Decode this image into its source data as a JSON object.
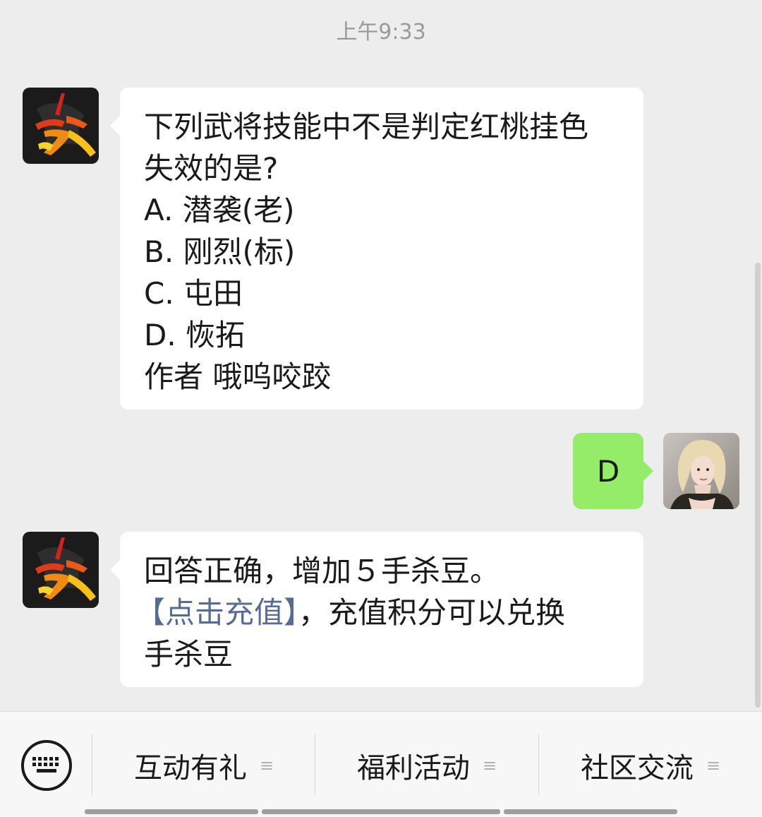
{
  "status": {
    "time": "上午9:33"
  },
  "messages": [
    {
      "sender": "bot",
      "lines": [
        "下列武将技能中不是判定红桃挂色",
        "失效的是?",
        "A. 潜袭(老)",
        "B. 刚烈(标)",
        "C. 屯田",
        "D. 恢拓",
        "作者 哦呜咬跤"
      ]
    },
    {
      "sender": "me",
      "text": "D"
    },
    {
      "sender": "bot",
      "line1": "回答正确，增加５手杀豆。",
      "link": "【点击充值】",
      "line2_rest": "，充值积分可以兑换",
      "line3": "手杀豆"
    }
  ],
  "menu": {
    "items": [
      {
        "label": "互动有礼",
        "sub_icon": "≡"
      },
      {
        "label": "福利活动",
        "sub_icon": "≡"
      },
      {
        "label": "社区交流",
        "sub_icon": "≡"
      }
    ]
  },
  "colors": {
    "background": "#ededed",
    "bubble_in": "#ffffff",
    "bubble_out": "#95ec69",
    "link": "#576b95"
  },
  "icons": {
    "bot_avatar": "sha-logo-icon",
    "user_avatar": "user-avatar-photo",
    "keyboard": "keyboard-icon"
  }
}
